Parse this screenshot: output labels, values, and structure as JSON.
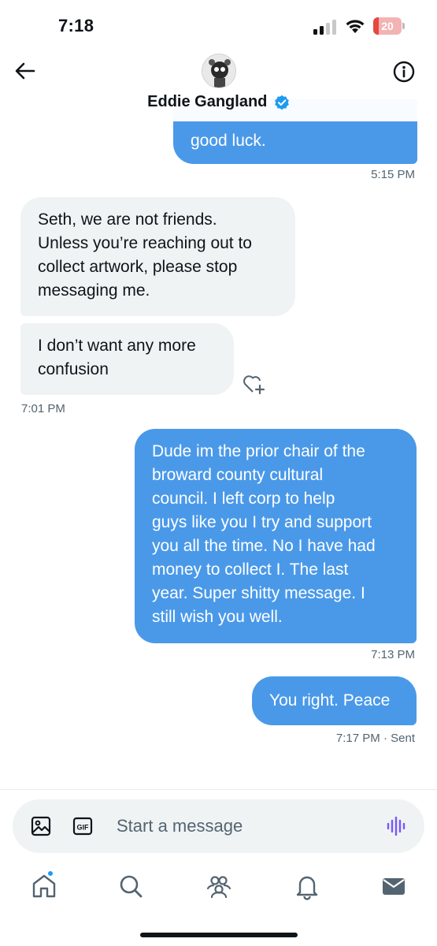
{
  "status_bar": {
    "time": "7:18",
    "battery": "20",
    "battery_level": 0.2,
    "battery_color": "#e5483e"
  },
  "header": {
    "name": "Eddie Gangland",
    "verified": true,
    "accent_color": "#1d9bf0",
    "icons": [
      "back-arrow-icon",
      "info-icon",
      "verified-badge-icon"
    ]
  },
  "messages": [
    {
      "direction": "outgoing",
      "text": "good luck."
    },
    {
      "time": "5:15 PM"
    },
    {
      "direction": "incoming",
      "text": "Seth, we are not friends.\nUnless you’re reaching out to\ncollect artwork, please stop\nmessaging me."
    },
    {
      "direction": "incoming",
      "text": "I don’t want any more\nconfusion"
    },
    {
      "time": "7:01 PM"
    },
    {
      "direction": "outgoing",
      "text": "Dude im the prior chair of the\nbroward county cultural\ncouncil. I left corp to help\nguys like you I try and support\nyou all the time. No I have had\nmoney to collect I. The last\nyear. Super shitty message. I\nstill wish you well."
    },
    {
      "time": "7:13 PM"
    },
    {
      "direction": "outgoing",
      "text": "You right. Peace"
    },
    {
      "time": "7:17 PM",
      "status": "· Sent"
    }
  ],
  "composer": {
    "placeholder": "Start a message",
    "icons": [
      "image-icon",
      "gif-icon",
      "voice-message-icon"
    ]
  },
  "bottom_nav": {
    "items": [
      "home-icon",
      "search-icon",
      "communities-icon",
      "notifications-icon",
      "messages-icon"
    ],
    "active": "messages-icon",
    "home_dot_color": "#1d9bf0"
  },
  "colors": {
    "outgoing_bubble": "#4a99e9",
    "incoming_bubble": "#eff3f4",
    "timestamp": "#536471",
    "voice_icon": "#7856ff"
  }
}
